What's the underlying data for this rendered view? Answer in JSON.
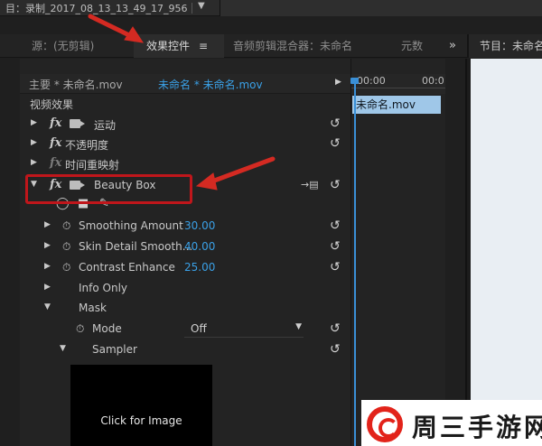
{
  "colors": {
    "accent_blue": "#3aa0e6",
    "highlight_red": "#c0161b",
    "clip_blue": "#9fc7e8"
  },
  "topbar": {
    "project_title": "目：录制_2017_08_13_13_49_17_956"
  },
  "tabs": {
    "source": "源：(无剪辑)",
    "effect_controls": "效果控件",
    "menu_icon": "≡",
    "audio_mixer": "音频剪辑混合器：未命名",
    "metadata": "元数",
    "overflow": "»",
    "program": "节目：未命名"
  },
  "sequence_bar": {
    "master": "主要 * 未命名.mov",
    "sequence": "未命名 * 未命名.mov"
  },
  "section": {
    "video_effects": "视频效果"
  },
  "effects": {
    "motion": "运动",
    "opacity": "不透明度",
    "time_remap": "时间重映射",
    "beauty_box": "Beauty Box"
  },
  "params": {
    "smoothing": {
      "label": "Smoothing Amount",
      "value": "30.00"
    },
    "skin_detail": {
      "label": "Skin Detail Smooth...",
      "value": "40.00"
    },
    "contrast": {
      "label": "Contrast Enhance",
      "value": "25.00"
    },
    "info_only": "Info Only",
    "mask": "Mask",
    "mode": {
      "label": "Mode",
      "value": "Off"
    },
    "sampler": "Sampler"
  },
  "preview": {
    "caption": "Click for Image"
  },
  "timeline": {
    "time_start": "00:00",
    "time_end": "00:0",
    "clip_name": "未命名.mov"
  },
  "watermark": {
    "text": "周三手游网"
  }
}
